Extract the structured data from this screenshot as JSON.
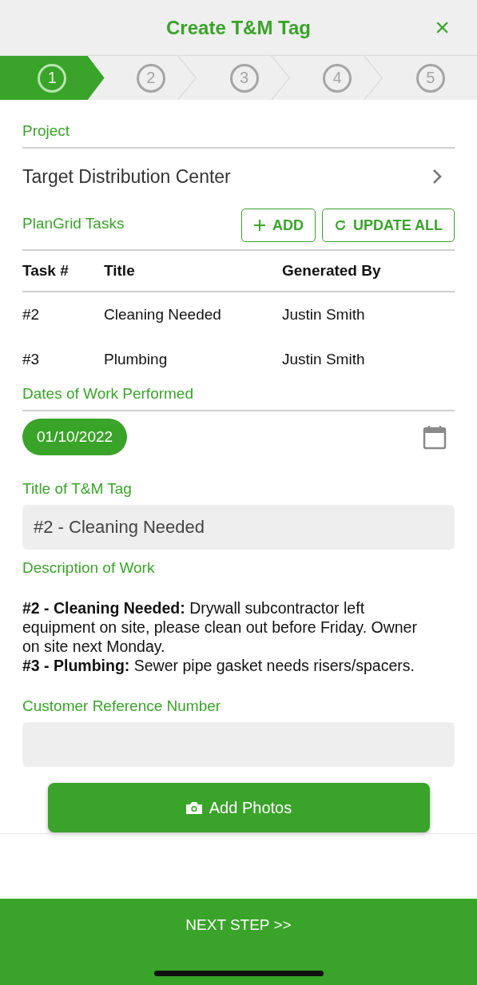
{
  "header": {
    "title": "Create T&M Tag",
    "close": "×"
  },
  "steps": [
    {
      "label": "1",
      "selected": true
    },
    {
      "label": "2",
      "selected": false
    },
    {
      "label": "3",
      "selected": false
    },
    {
      "label": "4",
      "selected": false
    },
    {
      "label": "5",
      "selected": false
    }
  ],
  "project": {
    "label": "Project",
    "value": "Target Distribution Center"
  },
  "tasks": {
    "label": "PlanGrid Tasks",
    "add_button": "ADD",
    "update_button": "UPDATE ALL",
    "columns": [
      "Task #",
      "Title",
      "Generated By"
    ],
    "rows": [
      [
        "#2",
        "Cleaning Needed",
        "Justin Smith"
      ],
      [
        "#3",
        "Plumbing",
        "Justin Smith"
      ]
    ]
  },
  "dates": {
    "label": "Dates of Work Performed",
    "chips": [
      "01/10/2022"
    ]
  },
  "tag_title": {
    "label": "Title of T&M Tag",
    "value": "#2 - Cleaning Needed"
  },
  "description": {
    "label": "Description of Work",
    "paragraphs": [
      "**#2 - Cleaning Needed:** Drywall subcontractor left equipment on site, please clean out before Friday. Owner on site next Monday.",
      "**#3 - Plumbing:** Sewer pipe gasket needs risers/spacers."
    ]
  },
  "customer_reference": {
    "label": "Customer Reference Number"
  },
  "add_photos_button": "Add Photos",
  "next_button": "NEXT STEP >>"
}
